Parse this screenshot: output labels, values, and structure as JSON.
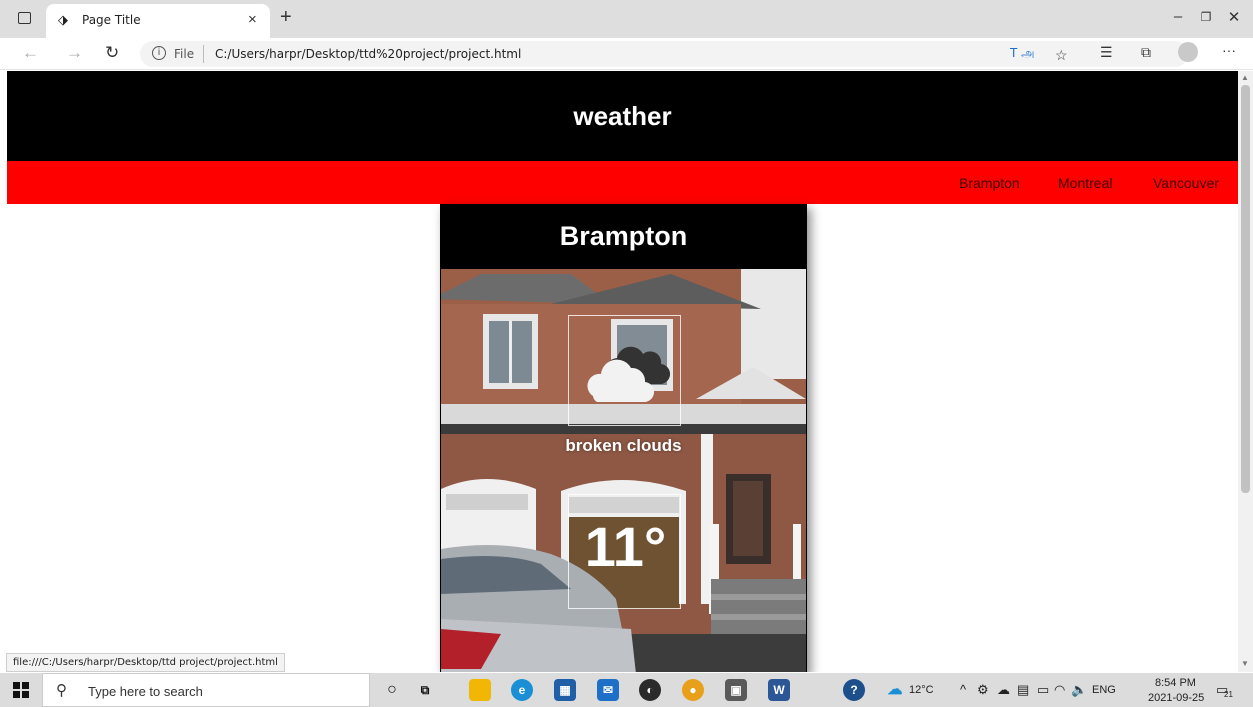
{
  "browser": {
    "tab_title": "Page Title",
    "new_tab_symbol": "+",
    "close_symbol": "×",
    "url_scheme": "File",
    "url": "C:/Users/harpr/Desktop/ttd%20project/project.html",
    "read_aloud": "T அ",
    "status_url": "file:///C:/Users/harpr/Desktop/ttd project/project.html"
  },
  "site": {
    "title": "weather",
    "nav": [
      "Brampton",
      "Montreal",
      "Vancouver"
    ]
  },
  "card": {
    "city": "Brampton",
    "description": "broken clouds",
    "temperature": "11°",
    "icon": "broken-clouds-icon"
  },
  "taskbar": {
    "search_placeholder": "Type here to search",
    "weather_temp": "12°C",
    "language": "ENG",
    "time": "8:54 PM",
    "date": "2021-09-25",
    "notification_count": "21"
  },
  "colors": {
    "header_bg": "#000000",
    "nav_bg": "#ff0000",
    "text_light": "#ffffff"
  }
}
